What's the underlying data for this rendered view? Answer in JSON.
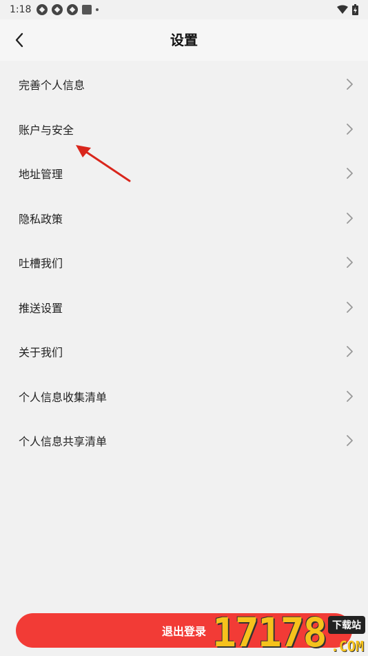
{
  "status_bar": {
    "time": "1:18"
  },
  "header": {
    "title": "设置"
  },
  "menu": {
    "items": [
      {
        "label": "完善个人信息"
      },
      {
        "label": "账户与安全"
      },
      {
        "label": "地址管理"
      },
      {
        "label": "隐私政策"
      },
      {
        "label": "吐槽我们"
      },
      {
        "label": "推送设置"
      },
      {
        "label": "关于我们"
      },
      {
        "label": "个人信息收集清单"
      },
      {
        "label": "个人信息共享清单"
      }
    ]
  },
  "logout": {
    "label": "退出登录"
  },
  "watermark": {
    "digits": "17178",
    "badge": "下载站",
    "suffix": ".COM"
  },
  "colors": {
    "accent": "#f23b36",
    "background": "#f1f1f1",
    "annotation": "#d9261c"
  }
}
